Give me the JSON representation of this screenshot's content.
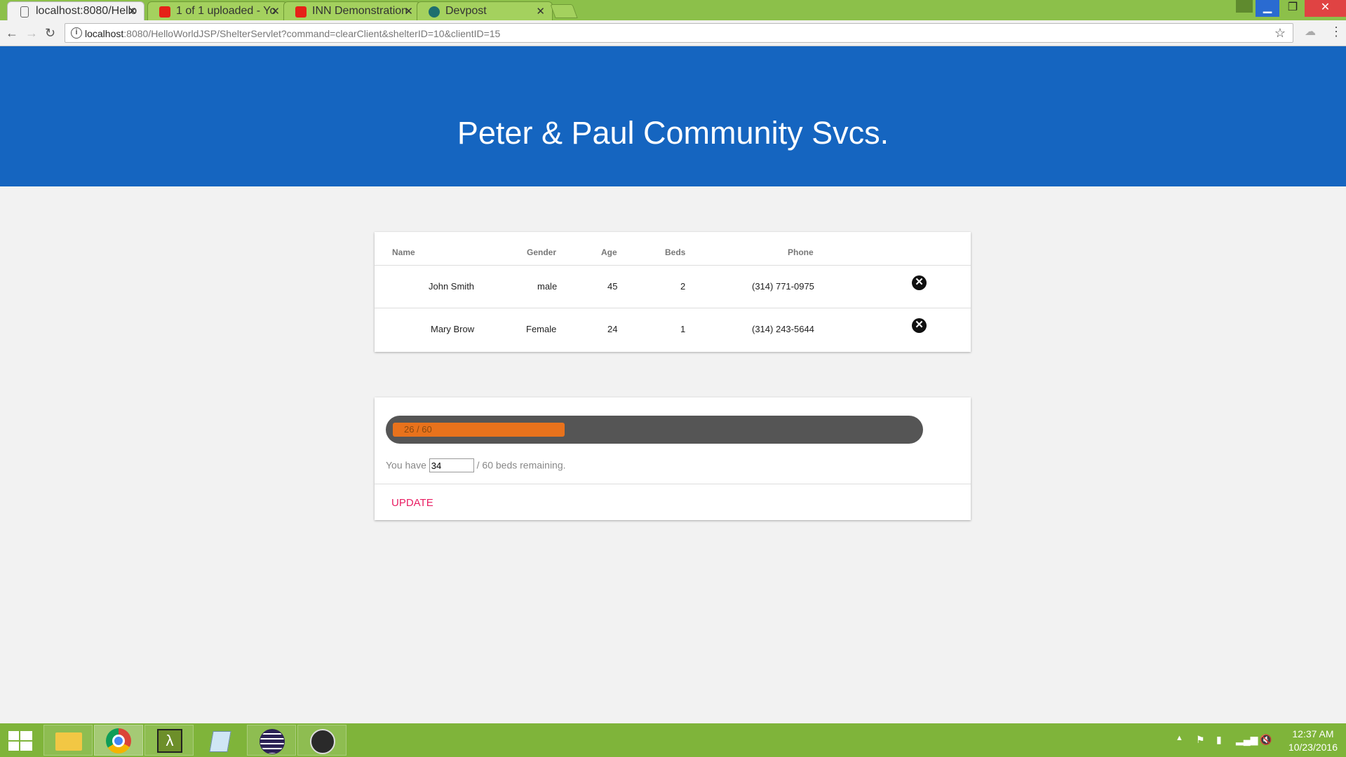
{
  "browser": {
    "tabs": [
      {
        "label": "localhost:8080/Hello",
        "favicon": "page-icon"
      },
      {
        "label": "1 of 1 uploaded - Yo",
        "favicon": "youtube-icon"
      },
      {
        "label": "INN Demonstration",
        "favicon": "youtube-icon"
      },
      {
        "label": "Devpost",
        "favicon": "devpost-icon"
      }
    ],
    "address": {
      "host": "localhost",
      "rest": ":8080/HelloWorldJSP/ShelterServlet?command=clearClient&shelterID=10&clientID=15"
    }
  },
  "page": {
    "title": "Peter & Paul Community Svcs.",
    "table": {
      "headers": [
        "Name",
        "Gender",
        "Age",
        "Beds",
        "Phone"
      ],
      "rows": [
        {
          "name": "John Smith",
          "gender": "male",
          "age": "45",
          "beds": "2",
          "phone": "(314) 771-0975"
        },
        {
          "name": "Mary Brow",
          "gender": "Female",
          "age": "24",
          "beds": "1",
          "phone": "(314) 243-5644"
        }
      ]
    },
    "capacity": {
      "progress_label": "26 / 60",
      "progress_fraction": 0.433,
      "text_before": "You have",
      "remaining_value": "34",
      "text_after": "/ 60 beds remaining.",
      "update_label": "UPDATE"
    }
  },
  "taskbar": {
    "time": "12:37 AM",
    "date": "10/23/2016"
  },
  "colors": {
    "header": "#1565c0",
    "progress_fill": "#e8721c",
    "update": "#e91e63",
    "taskbar": "#7fb43a"
  }
}
